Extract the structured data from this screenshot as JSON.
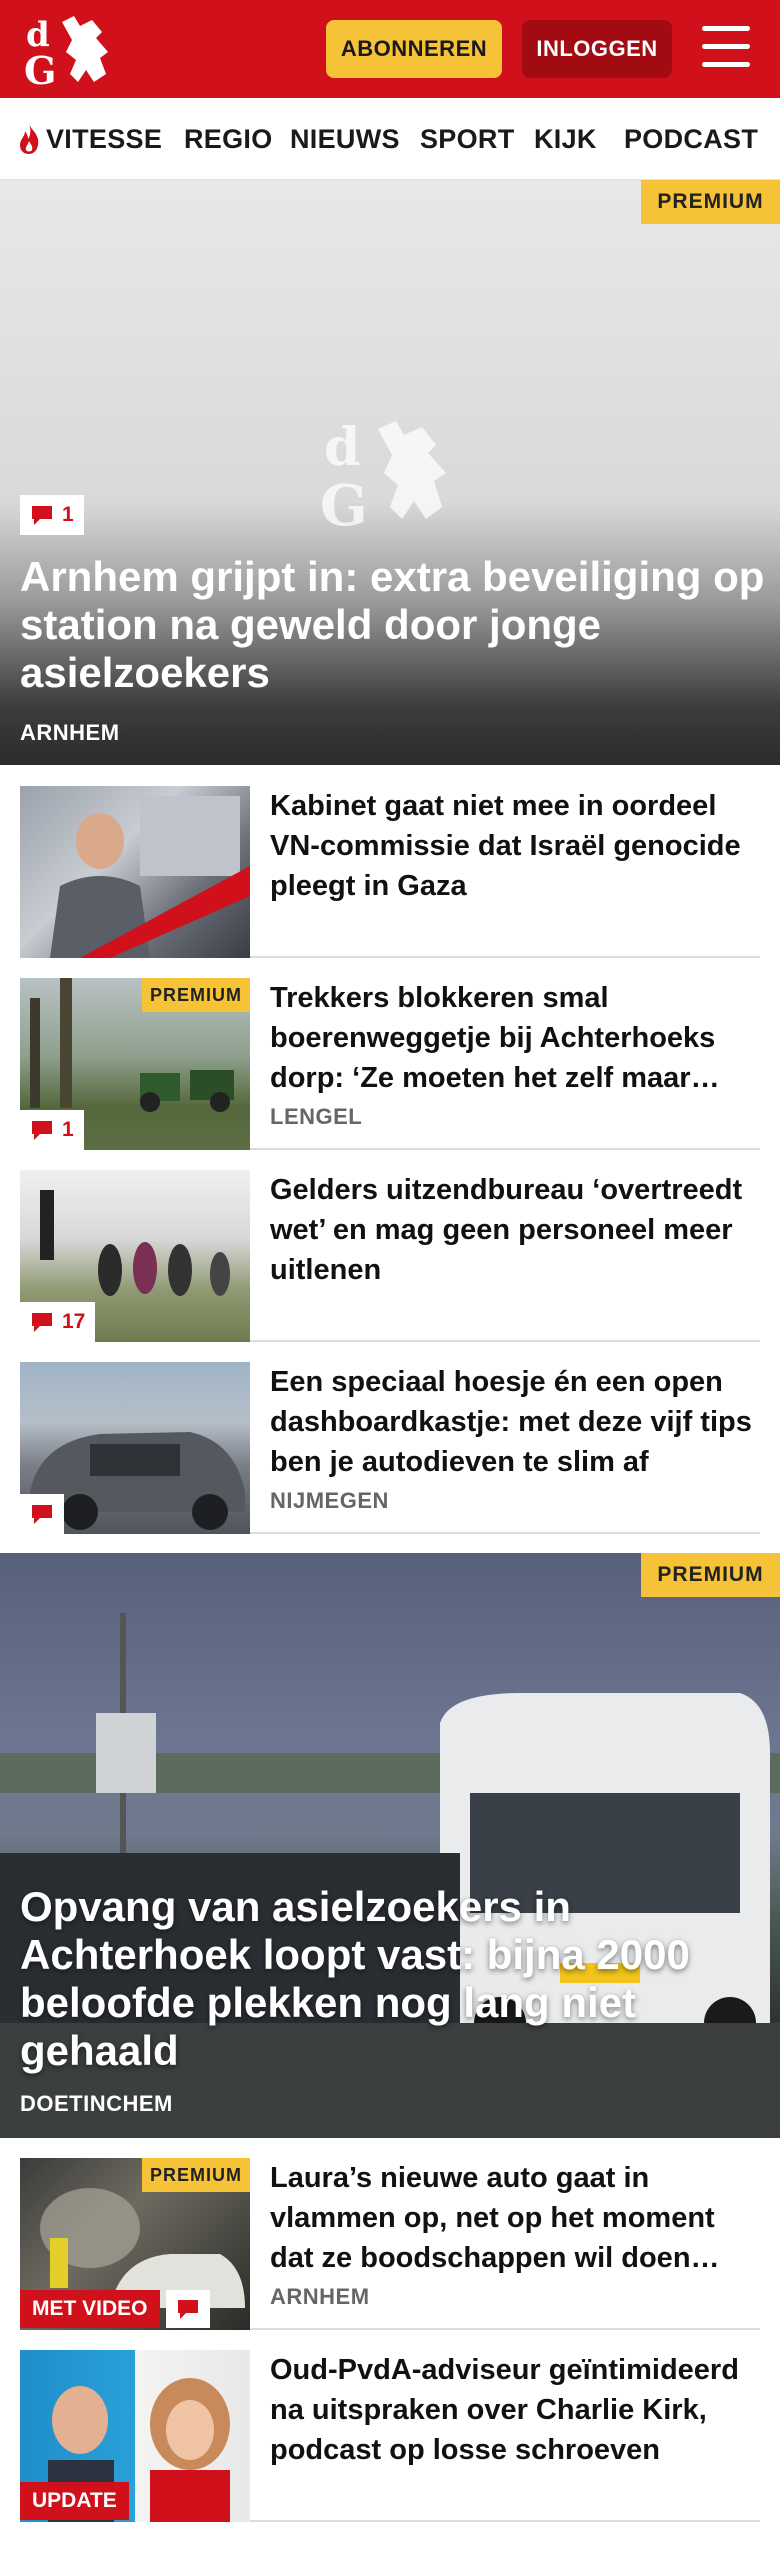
{
  "header": {
    "logo_text": "dG",
    "subscribe_label": "ABONNEREN",
    "login_label": "INLOGGEN"
  },
  "nav": {
    "items": [
      {
        "label": "VITESSE",
        "icon": "flame-icon"
      },
      {
        "label": "REGIO"
      },
      {
        "label": "NIEUWS"
      },
      {
        "label": "SPORT"
      },
      {
        "label": "KIJK"
      },
      {
        "label": "PODCAST"
      }
    ]
  },
  "colors": {
    "brand_red": "#d0101a",
    "premium_yellow": "#f5c238",
    "login_dark_red": "#a30b12"
  },
  "hero": {
    "premium_label": "PREMIUM",
    "comment_count": "1",
    "title": "Arnhem grijpt in: extra beveiliging op station na geweld door jonge asielzoe­kers",
    "location": "ARNHEM"
  },
  "articles": [
    {
      "title": "Kabinet gaat niet mee in oordeel VN-commissie dat Israël genocide pleegt in Gaza",
      "location": "",
      "premium": false,
      "comments": ""
    },
    {
      "title": "Trekkers blokkeren smal boerenweggetje bij Achterhoeks dorp: ‘Ze moeten het zelf maar…",
      "location": "LENGEL",
      "premium": true,
      "premium_label": "PREMIUM",
      "comments": "1"
    },
    {
      "title": "Gelders uitzendbureau ‘overtreedt wet’ en mag geen personeel meer uitlenen",
      "location": "",
      "premium": false,
      "comments": "17"
    },
    {
      "title": "Een speciaal hoesje én een open dashboardkastje: met deze vijf tips ben je autodieven te slim af",
      "location": "NIJMEGEN",
      "premium": false,
      "comments": ""
    }
  ],
  "hero2": {
    "premium_label": "PREMIUM",
    "title": "Opvang van asielzoekers in Achterhoek loopt vast: bijna 2000 beloofde plekken nog lang niet gehaald",
    "location": "DOETINCHEM"
  },
  "articles2": [
    {
      "title": "Laura’s nieuwe auto gaat in vlammen op, net op het moment dat ze boodschappen wil doen…",
      "location": "ARNHEM",
      "premium_label": "PREMIUM",
      "tag": "MET VIDEO"
    },
    {
      "title": "Oud-PvdA-adviseur geïntimi­deerd na uitspraken over Charlie Kirk, podcast op losse schroeven",
      "location": "",
      "tag": "UPDATE"
    }
  ]
}
